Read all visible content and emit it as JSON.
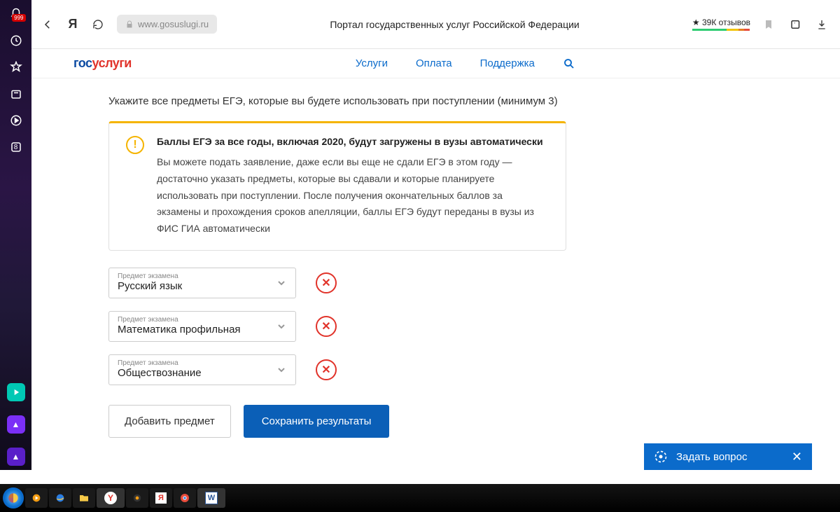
{
  "os_sidebar": {
    "badge": "999",
    "small_badge": "8"
  },
  "browser": {
    "url": "www.gosuslugi.ru",
    "page_title": "Портал государственных услуг Российской Федерации",
    "reviews": "39К отзывов"
  },
  "header": {
    "logo_part1": "гос",
    "logo_part2": "услуги",
    "nav": {
      "services": "Услуги",
      "payment": "Оплата",
      "support": "Поддержка"
    }
  },
  "main": {
    "instruction": "Укажите все предметы ЕГЭ, которые вы будете использовать при поступлении (минимум 3)",
    "info": {
      "title": "Баллы ЕГЭ за все годы, включая 2020, будут загружены в вузы автоматически",
      "body": "Вы можете подать заявление, даже если вы еще не сдали ЕГЭ в этом году — достаточно указать предметы, которые вы сдавали и которые планируете использовать при поступлении. После получения окончательных баллов за экзамены и прохождения сроков апелляции, баллы ЕГЭ будут переданы в вузы из ФИС ГИА автоматически"
    },
    "subject_label": "Предмет экзамена",
    "subjects": [
      {
        "value": "Русский язык"
      },
      {
        "value": "Математика профильная"
      },
      {
        "value": "Обществознание"
      }
    ],
    "add_button": "Добавить предмет",
    "save_button": "Сохранить результаты"
  },
  "chat": {
    "label": "Задать вопрос"
  }
}
